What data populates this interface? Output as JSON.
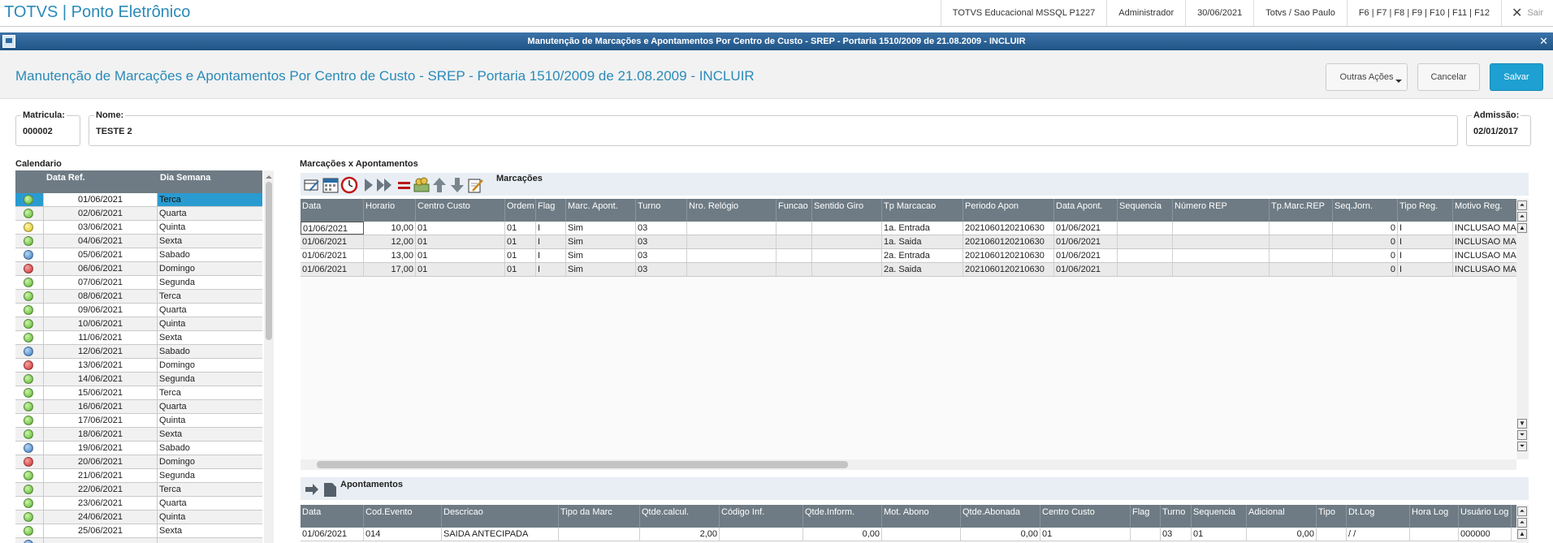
{
  "app": {
    "brand": "TOTVS | Ponto Eletrônico"
  },
  "topbar": {
    "company": "TOTVS Educacional MSSQL P1227",
    "user": "Administrador",
    "date": "30/06/2021",
    "location": "Totvs / Sao Paulo",
    "shortcuts": "F6 | F7 | F8 | F9 | F10 | F11 | F12",
    "exit": "Sair"
  },
  "window": {
    "title": "Manutenção de Marcações e Apontamentos Por Centro de Custo - SREP - Portaria 1510/2009 de 21.08.2009 - INCLUIR"
  },
  "header": {
    "title": "Manutenção de Marcações e Apontamentos Por Centro de Custo - SREP - Portaria 1510/2009 de 21.08.2009 - INCLUIR",
    "outras": "Outras Ações",
    "cancelar": "Cancelar",
    "salvar": "Salvar"
  },
  "fields": {
    "matricula_label": "Matricula:",
    "matricula": "000002",
    "nome_label": "Nome:",
    "nome": "TESTE 2",
    "admissao_label": "Admissão:",
    "admissao": "02/01/2017"
  },
  "calendar": {
    "title": "Calendario",
    "headers": [
      "Data Ref.",
      "Dia Semana"
    ],
    "rows": [
      {
        "status": "green",
        "date": "01/06/2021",
        "day": "Terca"
      },
      {
        "status": "green",
        "date": "02/06/2021",
        "day": "Quarta"
      },
      {
        "status": "yellow",
        "date": "03/06/2021",
        "day": "Quinta"
      },
      {
        "status": "green",
        "date": "04/06/2021",
        "day": "Sexta"
      },
      {
        "status": "blue",
        "date": "05/06/2021",
        "day": "Sabado"
      },
      {
        "status": "red",
        "date": "06/06/2021",
        "day": "Domingo"
      },
      {
        "status": "green",
        "date": "07/06/2021",
        "day": "Segunda"
      },
      {
        "status": "green",
        "date": "08/06/2021",
        "day": "Terca"
      },
      {
        "status": "green",
        "date": "09/06/2021",
        "day": "Quarta"
      },
      {
        "status": "green",
        "date": "10/06/2021",
        "day": "Quinta"
      },
      {
        "status": "green",
        "date": "11/06/2021",
        "day": "Sexta"
      },
      {
        "status": "blue",
        "date": "12/06/2021",
        "day": "Sabado"
      },
      {
        "status": "red",
        "date": "13/06/2021",
        "day": "Domingo"
      },
      {
        "status": "green",
        "date": "14/06/2021",
        "day": "Segunda"
      },
      {
        "status": "green",
        "date": "15/06/2021",
        "day": "Terca"
      },
      {
        "status": "green",
        "date": "16/06/2021",
        "day": "Quarta"
      },
      {
        "status": "green",
        "date": "17/06/2021",
        "day": "Quinta"
      },
      {
        "status": "green",
        "date": "18/06/2021",
        "day": "Sexta"
      },
      {
        "status": "blue",
        "date": "19/06/2021",
        "day": "Sabado"
      },
      {
        "status": "red",
        "date": "20/06/2021",
        "day": "Domingo"
      },
      {
        "status": "green",
        "date": "21/06/2021",
        "day": "Segunda"
      },
      {
        "status": "green",
        "date": "22/06/2021",
        "day": "Terca"
      },
      {
        "status": "green",
        "date": "23/06/2021",
        "day": "Quarta"
      },
      {
        "status": "green",
        "date": "24/06/2021",
        "day": "Quinta"
      },
      {
        "status": "green",
        "date": "25/06/2021",
        "day": "Sexta"
      },
      {
        "status": "blue",
        "date": "",
        "day": ""
      }
    ]
  },
  "marcacoes": {
    "section_title": "Marcações x Apontamentos",
    "toolbar_label": "Marcações",
    "headers": [
      "Data",
      "Horario",
      "Centro Custo",
      "Ordem",
      "Flag",
      "Marc. Apont.",
      "Turno",
      "Nro. Relógio",
      "Funcao",
      "Sentido Giro",
      "Tp Marcacao",
      "Periodo Apon",
      "Data Apont.",
      "Sequencia",
      "Número REP",
      "Tp.Marc.REP",
      "Seq.Jorn.",
      "Tipo Reg.",
      "Motivo Reg."
    ],
    "rows": [
      [
        "01/06/2021",
        "10,00",
        "01",
        "01",
        "I",
        "Sim",
        "03",
        "",
        "",
        "",
        "1a. Entrada",
        "2021060120210630",
        "01/06/2021",
        "",
        "",
        "",
        "0",
        "I",
        "INCLUSAO MAN"
      ],
      [
        "01/06/2021",
        "12,00",
        "01",
        "01",
        "I",
        "Sim",
        "03",
        "",
        "",
        "",
        "1a. Saida",
        "2021060120210630",
        "01/06/2021",
        "",
        "",
        "",
        "0",
        "I",
        "INCLUSAO MAN"
      ],
      [
        "01/06/2021",
        "13,00",
        "01",
        "01",
        "I",
        "Sim",
        "03",
        "",
        "",
        "",
        "2a. Entrada",
        "2021060120210630",
        "01/06/2021",
        "",
        "",
        "",
        "0",
        "I",
        "INCLUSAO MAN"
      ],
      [
        "01/06/2021",
        "17,00",
        "01",
        "01",
        "I",
        "Sim",
        "03",
        "",
        "",
        "",
        "2a. Saida",
        "2021060120210630",
        "01/06/2021",
        "",
        "",
        "",
        "0",
        "I",
        "INCLUSAO MAN"
      ]
    ]
  },
  "apontamentos": {
    "toolbar_label": "Apontamentos",
    "headers": [
      "Data",
      "Cod.Evento",
      "Descricao",
      "Tipo da Marc",
      "Qtde.calcul.",
      "Código Inf.",
      "Qtde.Inform.",
      "Mot. Abono",
      "Qtde.Abonada",
      "Centro Custo",
      "Flag",
      "Turno",
      "Sequencia",
      "Adicional",
      "Tipo",
      "Dt.Log",
      "Hora Log",
      "Usuário Log"
    ],
    "rows": [
      [
        "01/06/2021",
        "014",
        "SAIDA ANTECIPADA",
        "",
        "2,00",
        "",
        "0,00",
        "",
        "0,00",
        "01",
        "",
        "03",
        "01",
        "0,00",
        "",
        "  /  /",
        "",
        "000000"
      ]
    ]
  }
}
